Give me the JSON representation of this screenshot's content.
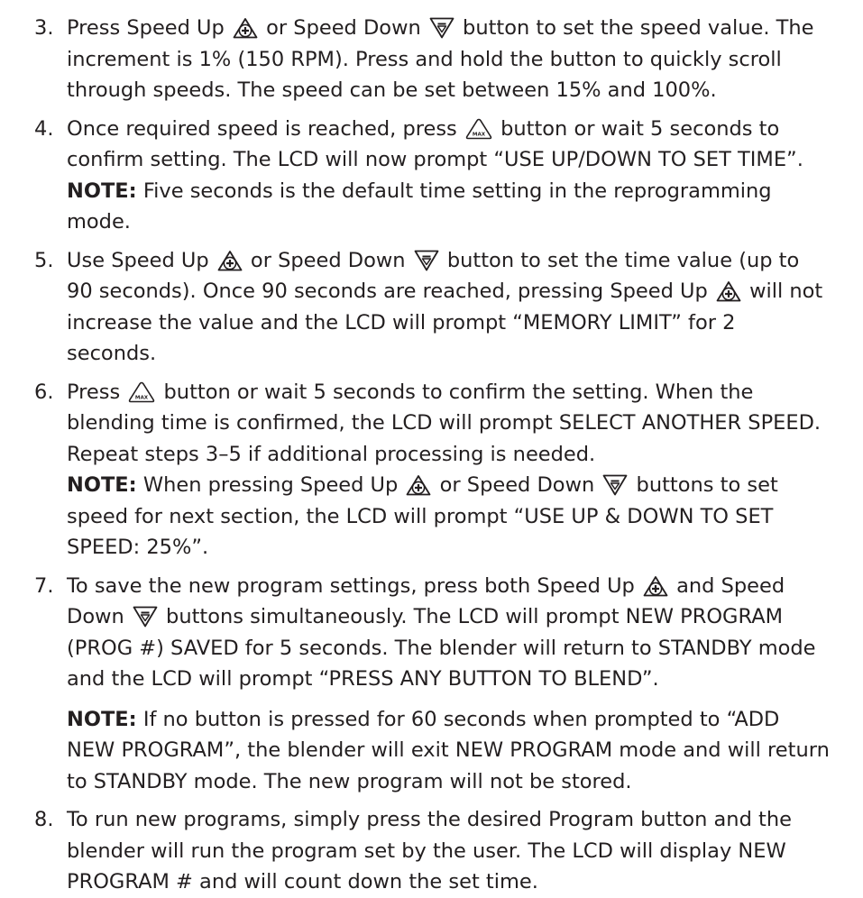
{
  "labels": {
    "speed_up": "Speed Up",
    "speed_down": "Speed Down",
    "note": "NOTE:",
    "max_icon_text": "MAX"
  },
  "icons": {
    "speed_up": "plus-in-triangle-icon",
    "speed_down": "down-arrow-triangle-icon",
    "max": "max-triangle-icon"
  },
  "steps": [
    {
      "number": "3.",
      "t1": "Press ",
      "t2": " or ",
      "t3": " button to set the speed value. The increment is 1% (150 RPM). Press and hold the button to quickly scroll through speeds. The speed can be set between 15% and 100%."
    },
    {
      "number": "4.",
      "t1": "Once required speed is reached, press ",
      "t2": " button or wait 5 seconds to confirm setting. The LCD will now prompt “USE UP/DOWN TO SET TIME”. ",
      "t3": " Five seconds is the default time setting in the reprogramming mode."
    },
    {
      "number": "5.",
      "t1": "Use ",
      "t2": " or ",
      "t3": " button to set the time value (up to 90 seconds). Once 90 seconds are reached, pressing ",
      "t4": " will not increase the value and the LCD will prompt “MEMORY LIMIT” for 2 seconds."
    },
    {
      "number": "6.",
      "t1": "Press ",
      "t2": " button or wait 5 seconds to confirm the setting. When the blending time is confirmed, the LCD will prompt SELECT ANOTHER SPEED. Repeat steps 3–5 if additional processing is needed.",
      "n1": " When pressing ",
      "n2": " or ",
      "n3": " buttons to set speed for next section, the LCD will prompt “USE UP & DOWN TO SET SPEED: 25%”."
    },
    {
      "number": "7.",
      "t1": "To save the new program settings, press both ",
      "t2": " and Speed Down ",
      "t3": " buttons simultaneously. The LCD will prompt NEW PROGRAM (PROG #) SAVED for 5 seconds. The blender will return to STANDBY mode and the LCD will prompt “PRESS ANY BUTTON TO BLEND”.",
      "n1": " If no button is pressed for 60 seconds when prompted to “ADD NEW PROGRAM”, the blender will exit NEW PROGRAM mode and will return to STANDBY mode. The new program will not be stored."
    },
    {
      "number": "8.",
      "t1": "To run new programs, simply press the desired Program button and the blender will run the program set by the user. The LCD will display NEW PROGRAM # and will count down the set time."
    }
  ]
}
